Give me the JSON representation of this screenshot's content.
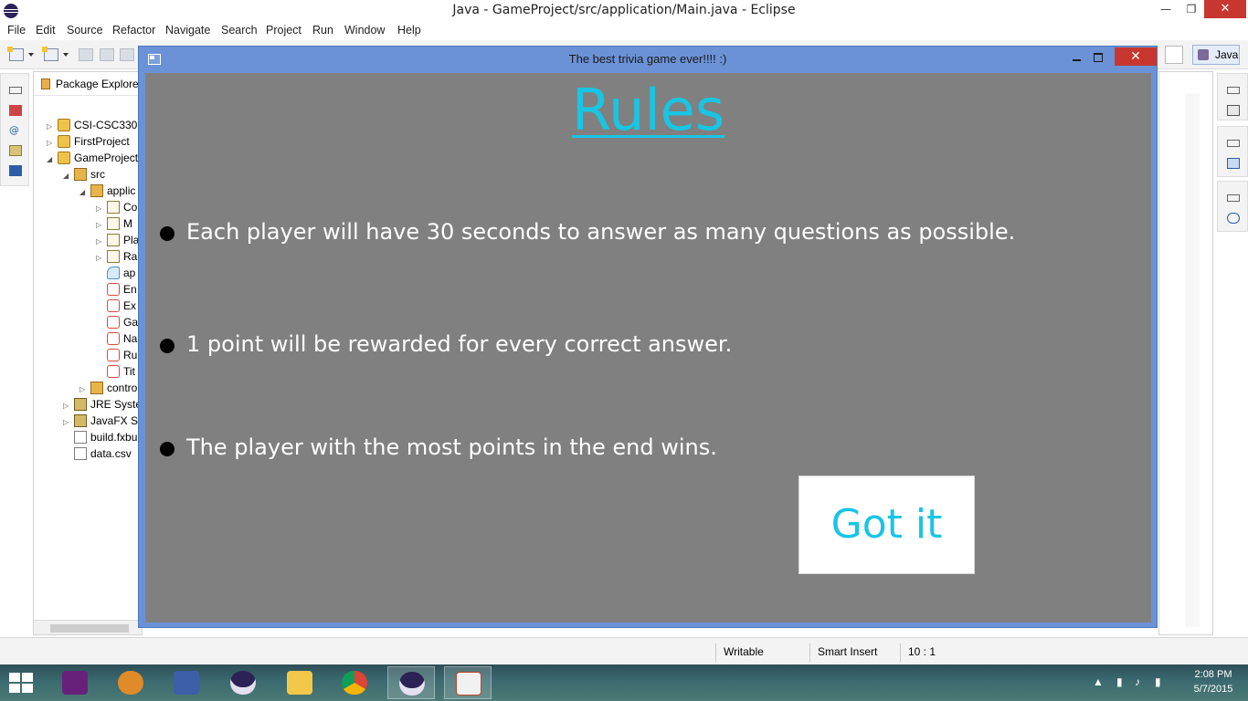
{
  "eclipse": {
    "title": "Java - GameProject/src/application/Main.java - Eclipse",
    "menu": [
      "File",
      "Edit",
      "Source",
      "Refactor",
      "Navigate",
      "Search",
      "Project",
      "Run",
      "Window",
      "Help"
    ],
    "perspective": "Java",
    "package_explorer": {
      "tab_label": "Package Explorer",
      "tree": [
        {
          "label": "CSI-CSC330",
          "icon": "project-icon"
        },
        {
          "label": "FirstProject",
          "icon": "project-icon"
        },
        {
          "label": "GameProject",
          "icon": "project-icon"
        },
        {
          "label": "src",
          "icon": "package-folder-icon"
        },
        {
          "label": "applic",
          "icon": "package-icon"
        },
        {
          "label": "Co",
          "icon": "java-file-icon"
        },
        {
          "label": "M",
          "icon": "java-file-icon"
        },
        {
          "label": "Pla",
          "icon": "java-file-icon"
        },
        {
          "label": "Ra",
          "icon": "java-file-icon"
        },
        {
          "label": "ap",
          "icon": "css-file-icon"
        },
        {
          "label": "En",
          "icon": "fxml-file-icon"
        },
        {
          "label": "Ex",
          "icon": "fxml-file-icon"
        },
        {
          "label": "Ga",
          "icon": "fxml-file-icon"
        },
        {
          "label": "Na",
          "icon": "fxml-file-icon"
        },
        {
          "label": "Ru",
          "icon": "fxml-file-icon"
        },
        {
          "label": "Tit",
          "icon": "fxml-file-icon"
        },
        {
          "label": "contro",
          "icon": "package-icon"
        },
        {
          "label": "JRE Syster",
          "icon": "library-icon"
        },
        {
          "label": "JavaFX SD",
          "icon": "library-icon"
        },
        {
          "label": "build.fxbu",
          "icon": "build-file-icon"
        },
        {
          "label": "data.csv",
          "icon": "file-icon"
        }
      ]
    },
    "status": {
      "writable": "Writable",
      "insert_mode": "Smart Insert",
      "cursor_position": "10 : 1"
    }
  },
  "game_window": {
    "title": "The best trivia game ever!!!!  :)",
    "heading": "Rules",
    "rules": [
      "Each player will have 30 seconds to answer as many questions as possible.",
      "1 point will be rewarded for every correct answer.",
      "The player with the most points in the end wins."
    ],
    "confirm_button": "Got it",
    "colors": {
      "accent": "#18c5e4",
      "background": "#808080",
      "frame": "#6b92d6"
    }
  },
  "taskbar": {
    "apps": [
      "visual-studio-icon",
      "eclipse-neon-icon",
      "intellij-icon",
      "eclipse-icon",
      "file-explorer-icon",
      "chrome-icon",
      "eclipse-icon",
      "java-icon"
    ],
    "time": "2:08 PM",
    "date": "5/7/2015"
  }
}
